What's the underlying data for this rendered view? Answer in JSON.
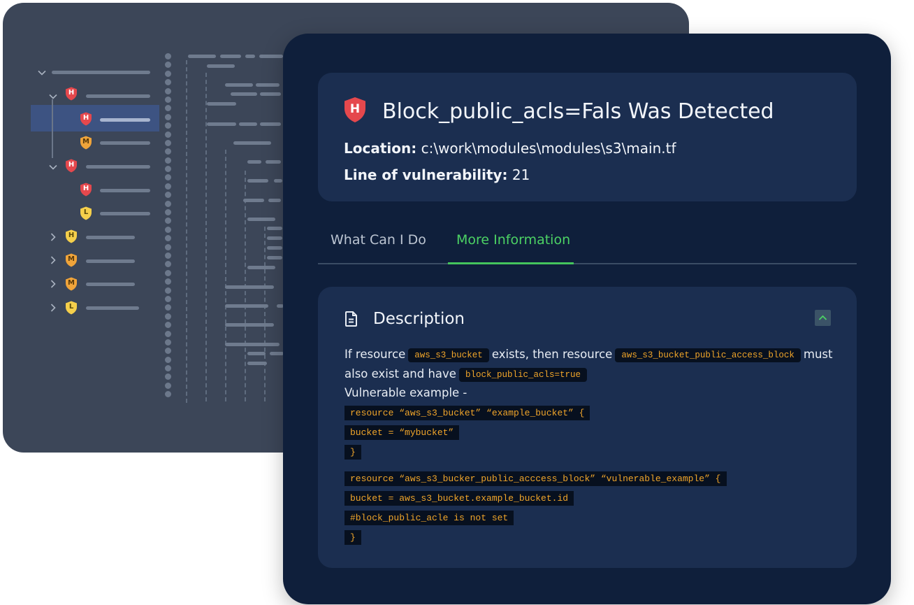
{
  "colors": {
    "back_panel": "#3c4658",
    "front_panel": "#0f1f3b",
    "card": "#1b2e50",
    "accent_green": "#4cd264",
    "code_text": "#f0a52a",
    "severity_high": "#e5484d",
    "severity_medium": "#f0a43a",
    "severity_low": "#f5cf4b"
  },
  "tree": {
    "badges": [
      "H",
      "H",
      "M",
      "H",
      "H",
      "L",
      "H",
      "M",
      "M",
      "L"
    ]
  },
  "finding": {
    "severity_badge": "H",
    "title": "Block_public_acls=Fals Was Detected",
    "location_label": "Location:",
    "location_value": "c:\\work\\modules\\modules\\s3\\main.tf",
    "line_label": "Line of vulnerability:",
    "line_value": "21"
  },
  "tabs": [
    {
      "label": "What Can I Do",
      "active": false
    },
    {
      "label": "More Information",
      "active": true
    }
  ],
  "description": {
    "title": "Description",
    "icon": "document-icon",
    "collapse_icon": "chevron-up-icon",
    "text_1": "If resource",
    "code_1": "aws_s3_bucket",
    "text_2": "exists, then resource",
    "code_2": "aws_s3_bucket_public_access_block",
    "text_3": "must",
    "text_4": "also exist and have",
    "code_3": "block_public_acls=true",
    "vulnerable_label": "Vulnerable example -",
    "code_block_1": [
      "resource “aws_s3_bucket” “example_bucket” {",
      "bucket = “mybucket”",
      "}"
    ],
    "code_block_2": [
      "resource “aws_s3_bucker_public_acccess_block” “vulnerable_example” {",
      "bucket = aws_s3_bucket.example_bucket.id",
      "#block_public_acle is not set",
      "}"
    ]
  }
}
